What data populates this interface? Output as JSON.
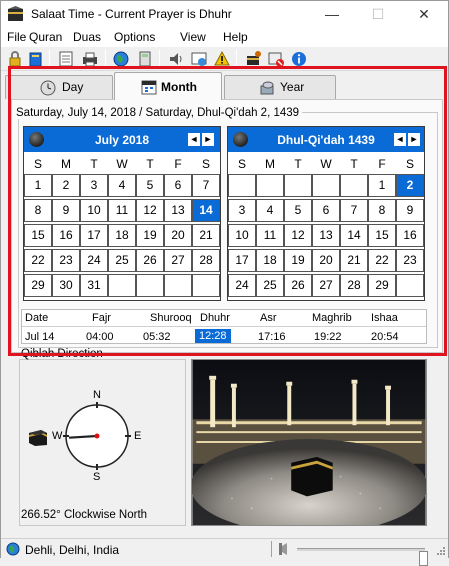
{
  "window": {
    "title": "Salaat Time - Current Prayer is Dhuhr",
    "minimize": "—",
    "maximize": "☐",
    "close": "✕"
  },
  "menu": [
    "File",
    "Quran",
    "Duas",
    "Options",
    "View",
    "Help"
  ],
  "toolbar_icons": [
    "lock-icon",
    "quran-book-icon",
    "notepad-icon",
    "printer-icon",
    "globe-icon",
    "calculator-icon",
    "speaker-icon",
    "reminder-icon",
    "alert-icon",
    "settings-icon",
    "mute-icon",
    "info-icon"
  ],
  "tabs": [
    {
      "label": "Day",
      "icon": "clock-icon",
      "active": false
    },
    {
      "label": "Month",
      "icon": "calendar-icon",
      "active": true
    },
    {
      "label": "Year",
      "icon": "year-icon",
      "active": false
    }
  ],
  "date_caption": "Saturday, July 14, 2018 / Saturday, Dhul-Qi'dah 2, 1439",
  "weekdays": [
    "S",
    "M",
    "T",
    "W",
    "T",
    "F",
    "S"
  ],
  "gregorian_calendar": {
    "title": "July 2018",
    "prev": "◄",
    "next": "►",
    "weeks": [
      [
        "1",
        "2",
        "3",
        "4",
        "5",
        "6",
        "7"
      ],
      [
        "8",
        "9",
        "10",
        "11",
        "12",
        "13",
        "14"
      ],
      [
        "15",
        "16",
        "17",
        "18",
        "19",
        "20",
        "21"
      ],
      [
        "22",
        "23",
        "24",
        "25",
        "26",
        "27",
        "28"
      ],
      [
        "29",
        "30",
        "31",
        "",
        "",
        "",
        ""
      ]
    ],
    "selected": "14"
  },
  "hijri_calendar": {
    "title": "Dhul-Qi'dah 1439",
    "prev": "◄",
    "next": "►",
    "weeks": [
      [
        "",
        "",
        "",
        "",
        "",
        "1",
        "2"
      ],
      [
        "3",
        "4",
        "5",
        "6",
        "7",
        "8",
        "9"
      ],
      [
        "10",
        "11",
        "12",
        "13",
        "14",
        "15",
        "16"
      ],
      [
        "17",
        "18",
        "19",
        "20",
        "21",
        "22",
        "23"
      ],
      [
        "24",
        "25",
        "26",
        "27",
        "28",
        "29",
        ""
      ]
    ],
    "selected": "2"
  },
  "prayer_times": {
    "headers": [
      "Date",
      "Fajr",
      "Shurooq",
      "Dhuhr",
      "Asr",
      "Maghrib",
      "Ishaa"
    ],
    "row": [
      "Jul 14",
      "04:00",
      "05:32",
      "12:28",
      "17:16",
      "19:22",
      "20:54"
    ],
    "current_prayer": "Dhuhr"
  },
  "qibla": {
    "caption": "Qiblah Direction",
    "north": "N",
    "south": "S",
    "east": "E",
    "west": "W",
    "angle_deg": 266.52,
    "angle_text": "266.52° Clockwise North"
  },
  "status": {
    "location": "Dehli, Delhi, India",
    "volume": 0.99
  },
  "colors": {
    "accent": "#0a6bd6",
    "highlight_frame": "#e0141e"
  }
}
